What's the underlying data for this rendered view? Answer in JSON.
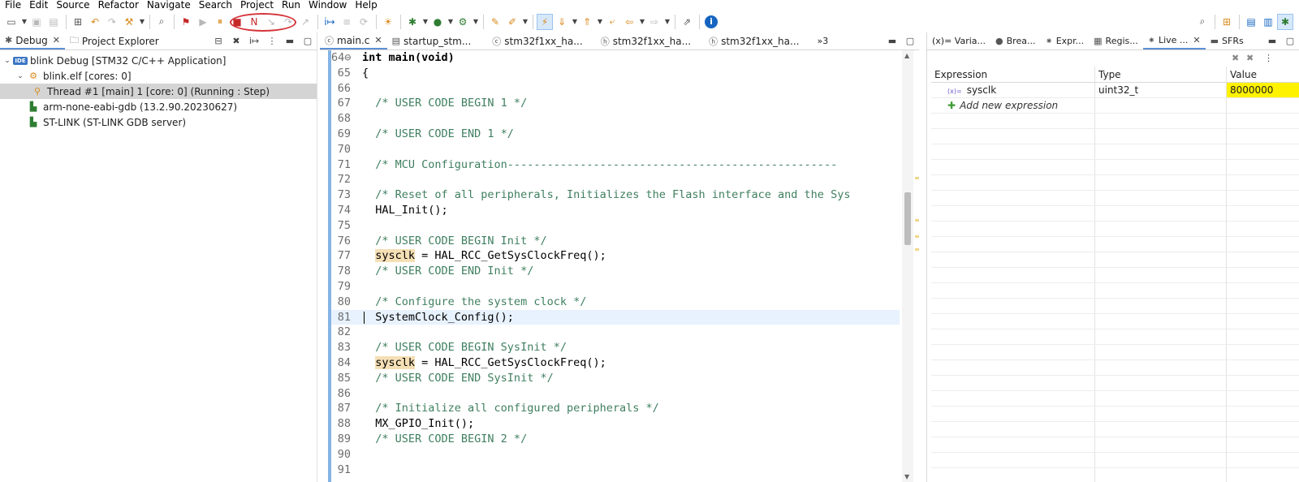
{
  "menubar": {
    "items": [
      "File",
      "Edit",
      "Source",
      "Refactor",
      "Navigate",
      "Search",
      "Project",
      "Run",
      "Window",
      "Help"
    ]
  },
  "toolbar": {
    "icons": [
      "new-icon",
      "save-icon",
      "save-all-icon",
      "binary-icon",
      "undo-icon",
      "redo-icon",
      "build-icon",
      "search-icon",
      "debug-stop-icon",
      "resume-icon",
      "suspend-icon",
      "terminate-icon",
      "disconnect-icon",
      "step-into-icon",
      "step-over-icon",
      "step-return-icon",
      "instruction-step-icon",
      "run-icon",
      "debug-icon",
      "external-tools-icon",
      "open-perspective-icon",
      "pin-icon",
      "toggle-mark-icon",
      "next-annotation-icon",
      "prev-annotation-icon",
      "back-icon",
      "forward-icon",
      "info-icon"
    ]
  },
  "left_pane": {
    "tabs": [
      {
        "label": "Debug",
        "active": true,
        "closable": true
      },
      {
        "label": "Project Explorer",
        "active": false,
        "closable": false
      }
    ],
    "tree": [
      {
        "label": "blink Debug [STM32 C/C++ Application]",
        "level": 0,
        "expanded": true,
        "icon": "ide-launch-icon",
        "badge": "IDE"
      },
      {
        "label": "blink.elf [cores: 0]",
        "level": 1,
        "expanded": true,
        "icon": "process-icon"
      },
      {
        "label": "Thread #1 [main] 1 [core: 0] (Running : Step)",
        "level": 2,
        "selected": true,
        "icon": "thread-icon"
      },
      {
        "label": "arm-none-eabi-gdb (13.2.90.20230627)",
        "level": 1,
        "icon": "gdb-icon"
      },
      {
        "label": "ST-LINK (ST-LINK GDB server)",
        "level": 1,
        "icon": "gdb-server-icon"
      }
    ]
  },
  "editor": {
    "tabs": [
      {
        "label": "main.c",
        "active": true,
        "closable": true
      },
      {
        "label": "startup_stm...",
        "active": false
      },
      {
        "label": "stm32f1xx_ha...",
        "active": false
      },
      {
        "label": "stm32f1xx_ha...",
        "active": false
      },
      {
        "label": "stm32f1xx_ha...",
        "active": false
      }
    ],
    "overflow_label": "»3",
    "lines": [
      {
        "n": "64⊖",
        "text": "int main(void)",
        "style": "kw"
      },
      {
        "n": "65",
        "text": "{",
        "style": ""
      },
      {
        "n": "66",
        "text": "",
        "style": ""
      },
      {
        "n": "67",
        "text": "  /* USER CODE BEGIN 1 */",
        "style": "comment"
      },
      {
        "n": "68",
        "text": "",
        "style": ""
      },
      {
        "n": "69",
        "text": "  /* USER CODE END 1 */",
        "style": "comment"
      },
      {
        "n": "70",
        "text": "",
        "style": ""
      },
      {
        "n": "71",
        "text": "  /* MCU Configuration--------------------------------------------------",
        "style": "comment"
      },
      {
        "n": "72",
        "text": "",
        "style": ""
      },
      {
        "n": "73",
        "text": "  /* Reset of all peripherals, Initializes the Flash interface and the Sys",
        "style": "comment"
      },
      {
        "n": "74",
        "text": "  HAL_Init();",
        "style": ""
      },
      {
        "n": "75",
        "text": "",
        "style": ""
      },
      {
        "n": "76",
        "text": "  /* USER CODE BEGIN Init */",
        "style": "comment"
      },
      {
        "n": "77",
        "pre": "  ",
        "hl": "sysclk",
        "text": " = HAL_RCC_GetSysClockFreq();",
        "style": ""
      },
      {
        "n": "78",
        "text": "  /* USER CODE END Init */",
        "style": "comment"
      },
      {
        "n": "79",
        "text": "",
        "style": ""
      },
      {
        "n": "80",
        "text": "  /* Configure the system clock */",
        "style": "comment"
      },
      {
        "n": "81",
        "text": "  SystemClock_Config();",
        "style": "",
        "current": true
      },
      {
        "n": "82",
        "text": "",
        "style": ""
      },
      {
        "n": "83",
        "text": "  /* USER CODE BEGIN SysInit */",
        "style": "comment"
      },
      {
        "n": "84",
        "pre": "  ",
        "hl": "sysclk",
        "text": " = HAL_RCC_GetSysClockFreq();",
        "style": ""
      },
      {
        "n": "85",
        "text": "  /* USER CODE END SysInit */",
        "style": "comment"
      },
      {
        "n": "86",
        "text": "",
        "style": ""
      },
      {
        "n": "87",
        "text": "  /* Initialize all configured peripherals */",
        "style": "comment"
      },
      {
        "n": "88",
        "text": "  MX_GPIO_Init();",
        "style": ""
      },
      {
        "n": "89",
        "text": "  /* USER CODE BEGIN 2 */",
        "style": "comment"
      },
      {
        "n": "90",
        "text": "",
        "style": ""
      },
      {
        "n": "91",
        "text": "",
        "style": ""
      }
    ]
  },
  "right_pane": {
    "tabs": [
      {
        "label": "(x)= Varia...",
        "active": false
      },
      {
        "label": "Brea...",
        "active": false
      },
      {
        "label": "Expr...",
        "active": false
      },
      {
        "label": "Regis...",
        "active": false
      },
      {
        "label": "Live ...",
        "active": true,
        "closable": true
      },
      {
        "label": "SFRs",
        "active": false
      }
    ],
    "columns": [
      "Expression",
      "Type",
      "Value"
    ],
    "rows": [
      {
        "expression": "sysclk",
        "type": "uint32_t",
        "value": "8000000",
        "changed": true
      }
    ],
    "add_label": "Add new expression"
  },
  "colors": {
    "changed_value": "#fff200",
    "annotation": "#d5343a",
    "current_line": "#e8f2fe",
    "occurrence": "#f5dfb5"
  }
}
